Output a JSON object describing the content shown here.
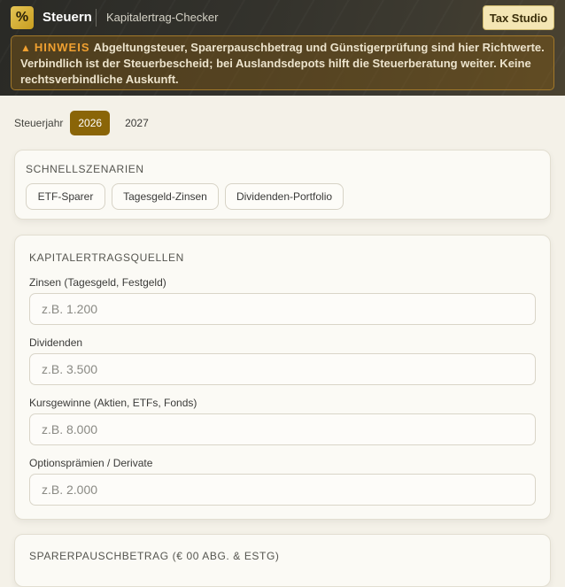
{
  "header": {
    "logo_glyph": "%",
    "app_name": "Steuern",
    "app_subtitle": "Kapitalertrag-Checker",
    "studio_button": "Tax Studio",
    "notice": {
      "icon": "warning-icon",
      "label": "HINWEIS",
      "text": "Abgeltungsteuer, Sparerpauschbetrag und Günstigerprüfung sind hier Richtwerte. Verbindlich ist der Steuerbescheid; bei Auslandsdepots hilft die Steuerberatung weiter. Keine rechtsverbindliche Auskunft."
    }
  },
  "year_selector": {
    "label": "Steuerjahr",
    "options": [
      "2026",
      "2027"
    ],
    "selected": "2026"
  },
  "quick_scenarios": {
    "title": "SCHNELLSZENARIEN",
    "items": [
      "ETF-Sparer",
      "Tagesgeld-Zinsen",
      "Dividenden-Portfolio"
    ]
  },
  "income_sources": {
    "title": "KAPITALERTRAGSQUELLEN",
    "fields": [
      {
        "label": "Zinsen (Tagesgeld, Festgeld)",
        "placeholder": "z.B. 1.200",
        "value": ""
      },
      {
        "label": "Dividenden",
        "placeholder": "z.B. 3.500",
        "value": ""
      },
      {
        "label": "Kursgewinne (Aktien, ETFs, Fonds)",
        "placeholder": "z.B. 8.000",
        "value": ""
      },
      {
        "label": "Optionsprämien / Derivate",
        "placeholder": "z.B. 2.000",
        "value": ""
      }
    ]
  },
  "next_section": {
    "title": "SPARERPAUSCHBETRAG (€ 00 ABG. & ESTG)"
  },
  "colors": {
    "accent": "#8a6508",
    "header_bg": "#2f2e28",
    "notice_label": "#f0a030",
    "page_bg": "#f4f1e8"
  }
}
